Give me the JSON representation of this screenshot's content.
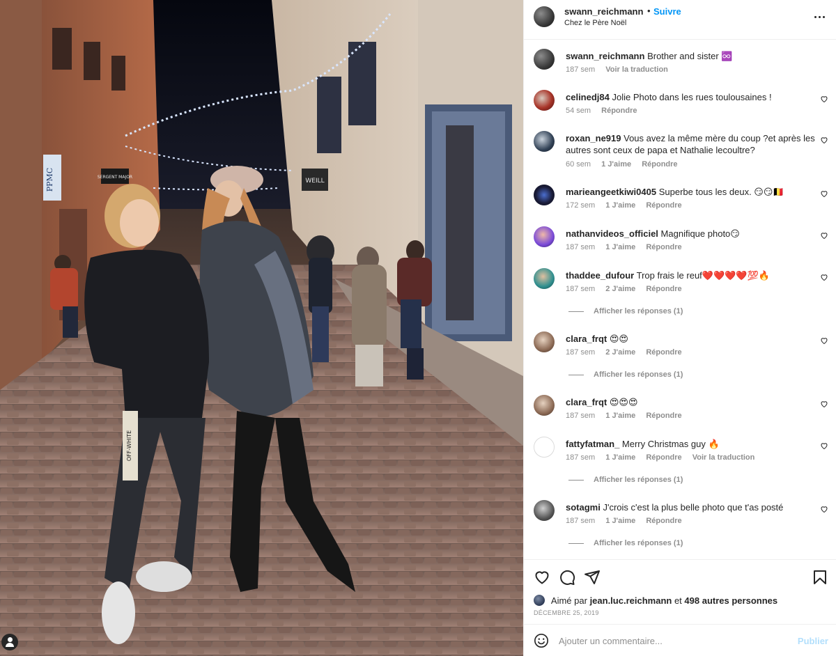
{
  "post": {
    "username": "swann_reichmann",
    "separator": "•",
    "follow_label": "Suivre",
    "location": "Chez le Père Noël",
    "caption_text": "Brother and sister ♾️",
    "caption_time": "187 sem",
    "caption_translate": "Voir la traduction"
  },
  "comments": [
    {
      "user": "celinedj84",
      "text": "Jolie Photo dans les rues toulousaines !",
      "time": "54 sem",
      "likes": "",
      "reply": "Répondre",
      "translate": "",
      "replies": ""
    },
    {
      "user": "roxan_ne919",
      "text": "Vous avez la même mère du coup ?et après les autres sont ceux de papa et Nathalie lecoultre?",
      "time": "60 sem",
      "likes": "1 J'aime",
      "reply": "Répondre",
      "translate": "",
      "replies": ""
    },
    {
      "user": "marieangeetkiwi0405",
      "text": "Superbe tous les deux. 😏😏🇧🇪",
      "time": "172 sem",
      "likes": "1 J'aime",
      "reply": "Répondre",
      "translate": "",
      "replies": ""
    },
    {
      "user": "nathanvideos_officiel",
      "text": "Magnifique photo😏",
      "time": "187 sem",
      "likes": "1 J'aime",
      "reply": "Répondre",
      "translate": "",
      "replies": ""
    },
    {
      "user": "thaddee_dufour",
      "text": "Trop frais le reuf❤️❤️❤️❤️💯🔥",
      "time": "187 sem",
      "likes": "2 J'aime",
      "reply": "Répondre",
      "translate": "",
      "replies": "Afficher les réponses (1)"
    },
    {
      "user": "clara_frqt",
      "text": "😍😍",
      "time": "187 sem",
      "likes": "2 J'aime",
      "reply": "Répondre",
      "translate": "",
      "replies": "Afficher les réponses (1)"
    },
    {
      "user": "clara_frqt",
      "text": "😍😍😍",
      "time": "187 sem",
      "likes": "1 J'aime",
      "reply": "Répondre",
      "translate": "",
      "replies": ""
    },
    {
      "user": "fattyfatman_",
      "text": "Merry Christmas guy 🔥",
      "time": "187 sem",
      "likes": "1 J'aime",
      "reply": "Répondre",
      "translate": "Voir la traduction",
      "replies": "Afficher les réponses (1)"
    },
    {
      "user": "sotagmi",
      "text": "J'crois c'est la plus belle photo que t'as posté",
      "time": "187 sem",
      "likes": "1 J'aime",
      "reply": "Répondre",
      "translate": "",
      "replies": "Afficher les réponses (1)"
    }
  ],
  "likes": {
    "prefix": "Aimé par",
    "user": "jean.luc.reichmann",
    "connector": "et",
    "others": "498 autres personnes"
  },
  "date": "DÉCEMBRE 25, 2019",
  "composer": {
    "placeholder": "Ajouter un commentaire...",
    "publish_label": "Publier"
  },
  "photo_signs": {
    "sign_left": "PPMC",
    "sign_sergent": "SERGENT MAJOR",
    "sign_weill": "WEILL",
    "bracelet": "OFF-WHITE"
  },
  "icons": {
    "like": "heart-icon",
    "comment": "speech-bubble-icon",
    "share": "paper-plane-icon",
    "save": "bookmark-icon",
    "more": "more-options-icon",
    "emoji": "emoji-icon"
  },
  "colors": {
    "accent": "#0095f6",
    "muted": "#8e8e8e",
    "text": "#262626",
    "publish_disabled": "#b2dffc"
  }
}
